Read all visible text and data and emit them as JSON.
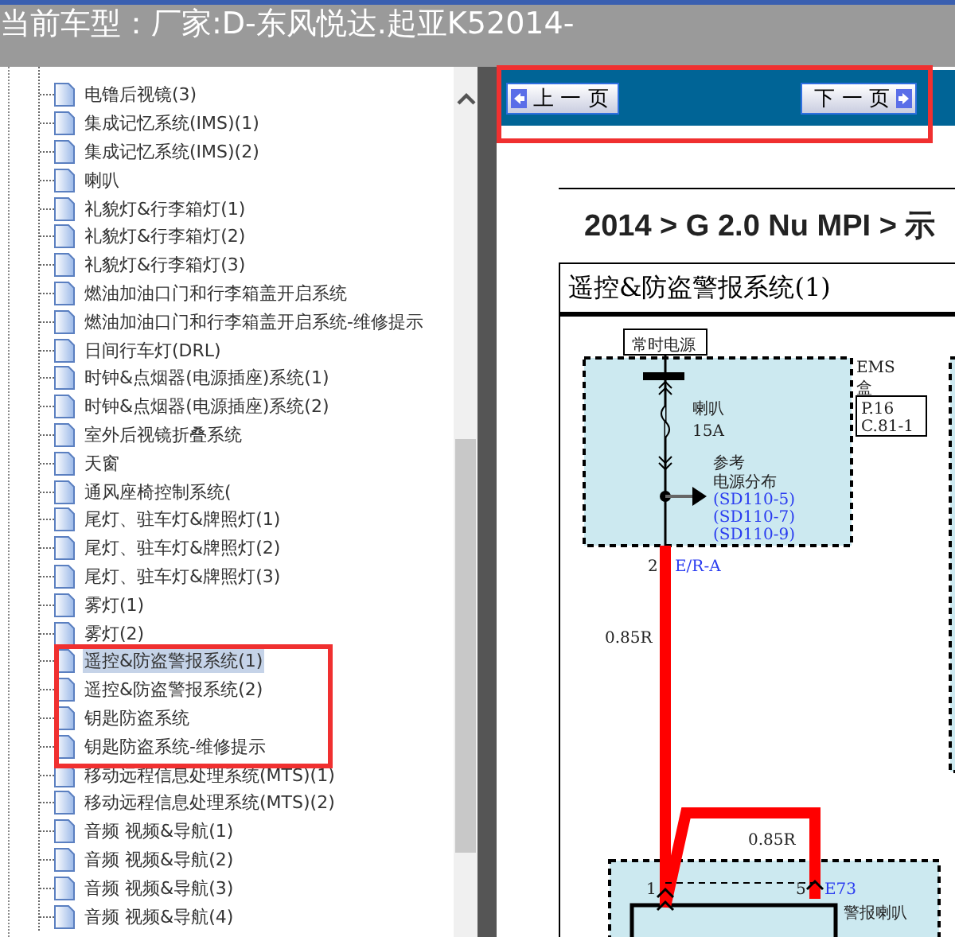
{
  "header": {
    "title": "当前车型：厂家:D-东风悦达.起亚K52014-"
  },
  "tree": {
    "items": [
      {
        "label": "电镥后视镜(3)",
        "selected": false
      },
      {
        "label": "集成记忆系统(IMS)(1)",
        "selected": false
      },
      {
        "label": "集成记忆系统(IMS)(2)",
        "selected": false
      },
      {
        "label": "喇叭",
        "selected": false
      },
      {
        "label": "礼貌灯&行李箱灯(1)",
        "selected": false
      },
      {
        "label": "礼貌灯&行李箱灯(2)",
        "selected": false
      },
      {
        "label": "礼貌灯&行李箱灯(3)",
        "selected": false
      },
      {
        "label": "燃油加油口门和行李箱盖开启系统",
        "selected": false
      },
      {
        "label": "燃油加油口门和行李箱盖开启系统-维修提示",
        "selected": false
      },
      {
        "label": "日间行车灯(DRL)",
        "selected": false
      },
      {
        "label": "时钟&点烟器(电源插座)系统(1)",
        "selected": false
      },
      {
        "label": "时钟&点烟器(电源插座)系统(2)",
        "selected": false
      },
      {
        "label": "室外后视镜折叠系统",
        "selected": false
      },
      {
        "label": "天窗",
        "selected": false
      },
      {
        "label": "通风座椅控制系统(",
        "selected": false
      },
      {
        "label": "尾灯、驻车灯&牌照灯(1)",
        "selected": false
      },
      {
        "label": "尾灯、驻车灯&牌照灯(2)",
        "selected": false
      },
      {
        "label": "尾灯、驻车灯&牌照灯(3)",
        "selected": false
      },
      {
        "label": "雾灯(1)",
        "selected": false
      },
      {
        "label": "雾灯(2)",
        "selected": false
      },
      {
        "label": "遥控&防盗警报系统(1)",
        "selected": true
      },
      {
        "label": "遥控&防盗警报系统(2)",
        "selected": false
      },
      {
        "label": "钥匙防盗系统",
        "selected": false
      },
      {
        "label": "钥匙防盗系统-维修提示",
        "selected": false
      },
      {
        "label": "移动远程信息处理系统(MTS)(1)",
        "selected": false
      },
      {
        "label": "移动远程信息处理系统(MTS)(2)",
        "selected": false
      },
      {
        "label": "音频 视频&导航(1)",
        "selected": false
      },
      {
        "label": "音频 视频&导航(2)",
        "selected": false
      },
      {
        "label": "音频 视频&导航(3)",
        "selected": false
      },
      {
        "label": "音频 视频&导航(4)",
        "selected": false
      }
    ]
  },
  "toolbar": {
    "prev": "上 一 页",
    "next": "下 一 页"
  },
  "document": {
    "breadcrumb": "2014 > G 2.0 Nu MPI > 示",
    "title": "遥控&防盗警报系统(1)",
    "labels": [
      "常时电源",
      "喇叭",
      "15A",
      "参考",
      "电源分布",
      "(SD110-5)",
      "(SD110-7)",
      "(SD110-9)",
      "EMS",
      "盒",
      "P.16",
      "C.81-1",
      "2",
      "E/R-A",
      "0.85R",
      "0.85R",
      "1",
      "5",
      "E73",
      "警报喇叭"
    ]
  }
}
